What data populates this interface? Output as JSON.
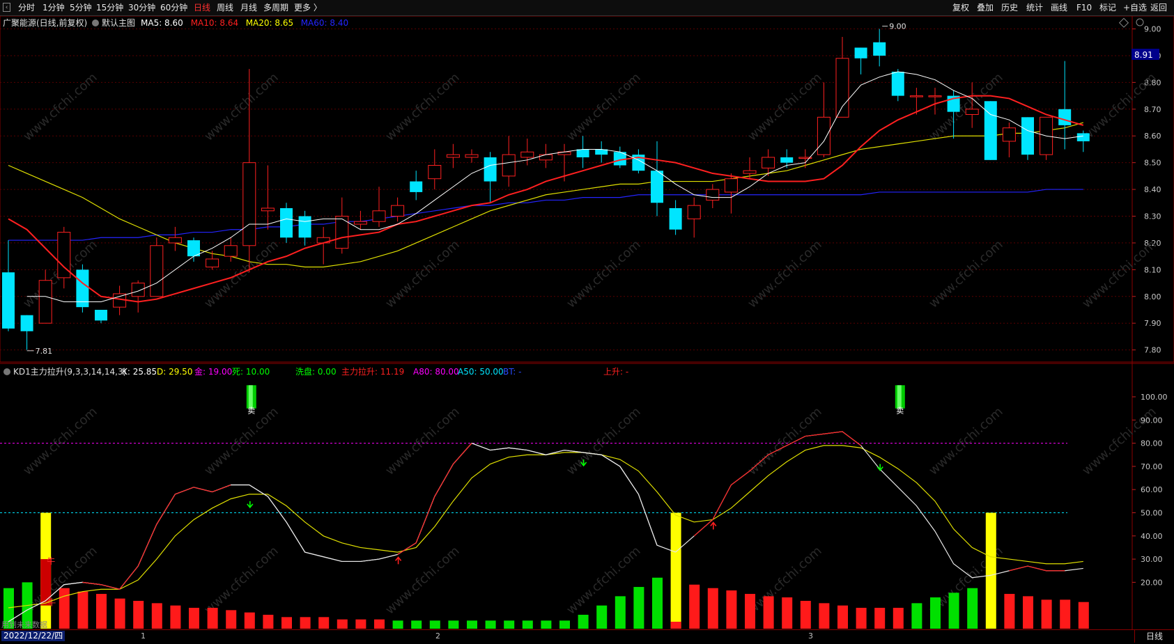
{
  "toolbar": {
    "left": [
      "分时",
      "1分钟",
      "5分钟",
      "15分钟",
      "30分钟",
      "60分钟",
      "日线",
      "周线",
      "月线",
      "多周期",
      "更多 〉"
    ],
    "active": "日线",
    "right": [
      "复权",
      "叠加",
      "历史",
      "统计",
      "画线",
      "F10",
      "标记",
      "+自选",
      "返回"
    ]
  },
  "main_header": {
    "stock": "广聚能源(日线,前复权)",
    "chart_name": "默认主图",
    "ma": [
      {
        "label": "MA5: 8.60",
        "color": "#ffffff"
      },
      {
        "label": "MA10: 8.64",
        "color": "#ff2020"
      },
      {
        "label": "MA20: 8.65",
        "color": "#ffff00"
      },
      {
        "label": "MA60: 8.40",
        "color": "#2424ff"
      }
    ]
  },
  "price_axis": [
    "9.00",
    "8.90",
    "8.80",
    "8.70",
    "8.60",
    "8.50",
    "8.40",
    "8.30",
    "8.20",
    "8.10",
    "8.00",
    "7.90",
    "7.80"
  ],
  "current_price": "8.91",
  "high_label": "9.00",
  "low_label": "7.81",
  "indicator_header": {
    "name": "KD1主力拉升(9,3,3,14,14,3)",
    "items": [
      {
        "label": "K: 25.85",
        "color": "#ffffff"
      },
      {
        "label": "D: 29.50",
        "color": "#ffff00"
      },
      {
        "label": "金: 19.00",
        "color": "#ff00ff"
      },
      {
        "label": "死: 10.00",
        "color": "#00ff00"
      },
      {
        "label": "洗盘: 0.00",
        "color": "#00ff00"
      },
      {
        "label": "主力拉升: 11.19",
        "color": "#ff2020"
      },
      {
        "label": "A80: 80.00",
        "color": "#ff00ff"
      },
      {
        "label": "A50: 50.00",
        "color": "#00e5ff"
      },
      {
        "label": "BT: -",
        "color": "#2a4bff"
      },
      {
        "label": "上升: -",
        "color": "#ff2020"
      }
    ]
  },
  "ind_axis": [
    "100.00",
    "90.00",
    "80.00",
    "70.00",
    "60.00",
    "50.00",
    "40.00",
    "30.00",
    "20.00"
  ],
  "signals": {
    "sell": "卖",
    "cow": "牛"
  },
  "bottom": {
    "date": "2022/12/22/四",
    "months": [
      "1",
      "2",
      "3"
    ],
    "future_note": "用到未来数据",
    "period_button": "日线"
  },
  "watermark": "www.cfchi.com",
  "colors": {
    "up": "#ff2020",
    "down": "#00e5ff",
    "ma5": "#ffffff",
    "ma10": "#ff2020",
    "ma20": "#e0e000",
    "ma60": "#2424ff",
    "k": "#e8e8e8",
    "d": "#e0e000"
  },
  "chart_data": {
    "type": "candlestick",
    "ylim": [
      7.76,
      9.03
    ],
    "candles": [
      [
        8.09,
        7.88,
        8.21,
        7.87
      ],
      [
        7.93,
        7.87,
        7.93,
        7.8
      ],
      [
        7.9,
        8.06,
        8.1,
        7.9
      ],
      [
        8.07,
        8.24,
        8.26,
        8.03
      ],
      [
        8.1,
        7.96,
        8.12,
        7.94
      ],
      [
        7.95,
        7.91,
        7.95,
        7.9
      ],
      [
        7.96,
        8.01,
        8.04,
        7.93
      ],
      [
        8.0,
        8.05,
        8.06,
        7.94
      ],
      [
        8.0,
        8.19,
        8.22,
        8.0
      ],
      [
        8.2,
        8.22,
        8.26,
        8.17
      ],
      [
        8.21,
        8.15,
        8.22,
        8.13
      ],
      [
        8.11,
        8.14,
        8.17,
        8.1
      ],
      [
        8.15,
        8.19,
        8.22,
        8.13
      ],
      [
        8.19,
        8.5,
        8.85,
        8.09
      ],
      [
        8.32,
        8.33,
        8.49,
        8.25
      ],
      [
        8.33,
        8.22,
        8.35,
        8.2
      ],
      [
        8.3,
        8.22,
        8.32,
        8.19
      ],
      [
        8.2,
        8.22,
        8.26,
        8.12
      ],
      [
        8.18,
        8.3,
        8.37,
        8.16
      ],
      [
        8.27,
        8.28,
        8.32,
        8.25
      ],
      [
        8.28,
        8.32,
        8.41,
        8.26
      ],
      [
        8.3,
        8.34,
        8.37,
        8.28
      ],
      [
        8.43,
        8.39,
        8.47,
        8.36
      ],
      [
        8.44,
        8.49,
        8.55,
        8.4
      ],
      [
        8.52,
        8.53,
        8.57,
        8.48
      ],
      [
        8.52,
        8.53,
        8.55,
        8.5
      ],
      [
        8.52,
        8.43,
        8.54,
        8.35
      ],
      [
        8.45,
        8.53,
        8.6,
        8.41
      ],
      [
        8.52,
        8.54,
        8.59,
        8.49
      ],
      [
        8.51,
        8.53,
        8.57,
        8.48
      ],
      [
        8.53,
        8.54,
        8.57,
        8.43
      ],
      [
        8.55,
        8.52,
        8.6,
        8.48
      ],
      [
        8.55,
        8.53,
        8.58,
        8.5
      ],
      [
        8.54,
        8.49,
        8.56,
        8.48
      ],
      [
        8.53,
        8.47,
        8.55,
        8.46
      ],
      [
        8.47,
        8.35,
        8.58,
        8.3
      ],
      [
        8.33,
        8.25,
        8.36,
        8.23
      ],
      [
        8.29,
        8.34,
        8.37,
        8.22
      ],
      [
        8.36,
        8.4,
        8.42,
        8.33
      ],
      [
        8.39,
        8.44,
        8.46,
        8.31
      ],
      [
        8.46,
        8.47,
        8.52,
        8.44
      ],
      [
        8.48,
        8.52,
        8.55,
        8.45
      ],
      [
        8.52,
        8.5,
        8.55,
        8.48
      ],
      [
        8.52,
        8.52,
        8.55,
        8.48
      ],
      [
        8.53,
        8.67,
        8.8,
        8.52
      ],
      [
        8.67,
        8.89,
        8.97,
        8.67
      ],
      [
        8.93,
        8.89,
        8.93,
        8.83
      ],
      [
        8.95,
        8.9,
        9.0,
        8.86
      ],
      [
        8.84,
        8.75,
        8.85,
        8.73
      ],
      [
        8.75,
        8.75,
        8.78,
        8.68
      ],
      [
        8.75,
        8.75,
        8.78,
        8.68
      ],
      [
        8.75,
        8.69,
        8.77,
        8.59
      ],
      [
        8.68,
        8.7,
        8.8,
        8.63
      ],
      [
        8.73,
        8.51,
        8.73,
        8.51
      ],
      [
        8.58,
        8.63,
        8.65,
        8.52
      ],
      [
        8.67,
        8.53,
        8.67,
        8.51
      ],
      [
        8.53,
        8.67,
        8.67,
        8.51
      ],
      [
        8.7,
        8.64,
        8.88,
        8.55
      ],
      [
        8.61,
        8.58,
        8.62,
        8.54
      ]
    ],
    "ma5": [
      null,
      8.0,
      8.0,
      7.98,
      7.98,
      7.98,
      8.0,
      8.02,
      8.05,
      8.1,
      8.15,
      8.18,
      8.22,
      8.27,
      8.27,
      8.29,
      8.28,
      8.29,
      8.29,
      8.25,
      8.25,
      8.27,
      8.31,
      8.36,
      8.41,
      8.46,
      8.49,
      8.5,
      8.51,
      8.53,
      8.54,
      8.55,
      8.55,
      8.54,
      8.51,
      8.47,
      8.42,
      8.38,
      8.37,
      8.37,
      8.41,
      8.46,
      8.49,
      8.5,
      8.58,
      8.71,
      8.79,
      8.82,
      8.84,
      8.83,
      8.81,
      8.77,
      8.74,
      8.68,
      8.66,
      8.62,
      8.6,
      8.59,
      8.6
    ],
    "ma10": [
      8.29,
      8.25,
      8.18,
      8.11,
      8.05,
      8.0,
      7.99,
      7.98,
      7.99,
      8.01,
      8.03,
      8.05,
      8.07,
      8.1,
      8.13,
      8.15,
      8.18,
      8.2,
      8.22,
      8.23,
      8.24,
      8.27,
      8.28,
      8.3,
      8.32,
      8.34,
      8.35,
      8.38,
      8.4,
      8.43,
      8.45,
      8.47,
      8.49,
      8.51,
      8.52,
      8.51,
      8.5,
      8.48,
      8.46,
      8.45,
      8.44,
      8.43,
      8.43,
      8.43,
      8.44,
      8.49,
      8.56,
      8.62,
      8.66,
      8.69,
      8.72,
      8.74,
      8.75,
      8.75,
      8.74,
      8.71,
      8.68,
      8.66,
      8.64
    ],
    "ma20": [
      8.49,
      8.46,
      8.43,
      8.4,
      8.37,
      8.33,
      8.29,
      8.26,
      8.23,
      8.2,
      8.18,
      8.16,
      8.15,
      8.13,
      8.12,
      8.12,
      8.11,
      8.11,
      8.12,
      8.13,
      8.15,
      8.17,
      8.2,
      8.23,
      8.26,
      8.29,
      8.32,
      8.34,
      8.36,
      8.38,
      8.39,
      8.4,
      8.41,
      8.42,
      8.42,
      8.43,
      8.43,
      8.43,
      8.43,
      8.44,
      8.45,
      8.46,
      8.47,
      8.49,
      8.51,
      8.53,
      8.55,
      8.56,
      8.57,
      8.58,
      8.59,
      8.6,
      8.6,
      8.6,
      8.61,
      8.61,
      8.62,
      8.63,
      8.65
    ],
    "ma60": [
      8.21,
      8.21,
      8.21,
      8.21,
      8.21,
      8.22,
      8.22,
      8.22,
      8.23,
      8.23,
      8.24,
      8.24,
      8.25,
      8.25,
      8.26,
      8.26,
      8.27,
      8.27,
      8.28,
      8.28,
      8.29,
      8.3,
      8.31,
      8.32,
      8.33,
      8.34,
      8.34,
      8.35,
      8.35,
      8.36,
      8.36,
      8.37,
      8.37,
      8.37,
      8.38,
      8.38,
      8.38,
      8.38,
      8.38,
      8.38,
      8.38,
      8.38,
      8.38,
      8.38,
      8.38,
      8.38,
      8.38,
      8.39,
      8.39,
      8.39,
      8.39,
      8.39,
      8.39,
      8.39,
      8.39,
      8.39,
      8.4,
      8.4,
      8.4
    ],
    "ind_ylim": [
      0,
      112
    ],
    "K": [
      3,
      8,
      12,
      19,
      20,
      19,
      17,
      27,
      45,
      58,
      61,
      59,
      62,
      62,
      57,
      46,
      33,
      31,
      29,
      29,
      30,
      32,
      37,
      57,
      71,
      80,
      77,
      78,
      77,
      75,
      77,
      76,
      75,
      70,
      58,
      36,
      33,
      40,
      47,
      62,
      68,
      75,
      79,
      83,
      84,
      85,
      79,
      69,
      61,
      53,
      42,
      28,
      22,
      23,
      25,
      27,
      25,
      25,
      26
    ],
    "D": [
      9,
      10,
      11,
      14,
      16,
      17,
      17,
      21,
      30,
      40,
      47,
      52,
      56,
      58,
      58,
      53,
      46,
      40,
      37,
      35,
      34,
      33,
      35,
      44,
      55,
      65,
      71,
      74,
      75,
      75,
      76,
      76,
      75,
      73,
      68,
      59,
      49,
      46,
      47,
      52,
      59,
      66,
      72,
      77,
      79,
      79,
      78,
      74,
      69,
      63,
      55,
      43,
      35,
      31,
      30,
      29,
      28,
      28,
      29
    ],
    "bars": [
      {
        "c": "green",
        "v": 17.5
      },
      {
        "c": "green",
        "v": 20
      },
      {
        "c": "yellow",
        "v": 50
      },
      {
        "c": "red",
        "v": 17.5
      },
      {
        "c": "red",
        "v": 16
      },
      {
        "c": "red",
        "v": 15
      },
      {
        "c": "red",
        "v": 13
      },
      {
        "c": "red",
        "v": 12
      },
      {
        "c": "red",
        "v": 11
      },
      {
        "c": "red",
        "v": 10
      },
      {
        "c": "red",
        "v": 9
      },
      {
        "c": "red",
        "v": 9
      },
      {
        "c": "red",
        "v": 8
      },
      {
        "c": "red",
        "v": 7
      },
      {
        "c": "red",
        "v": 6
      },
      {
        "c": "red",
        "v": 5
      },
      {
        "c": "red",
        "v": 5
      },
      {
        "c": "red",
        "v": 5
      },
      {
        "c": "red",
        "v": 4
      },
      {
        "c": "red",
        "v": 4
      },
      {
        "c": "red",
        "v": 4
      },
      {
        "c": "green",
        "v": 3.5
      },
      {
        "c": "green",
        "v": 3.5
      },
      {
        "c": "green",
        "v": 3.5
      },
      {
        "c": "green",
        "v": 3.5
      },
      {
        "c": "green",
        "v": 3.5
      },
      {
        "c": "green",
        "v": 3.5
      },
      {
        "c": "green",
        "v": 3.5
      },
      {
        "c": "green",
        "v": 3.5
      },
      {
        "c": "green",
        "v": 3.5
      },
      {
        "c": "green",
        "v": 3.5
      },
      {
        "c": "green",
        "v": 6
      },
      {
        "c": "green",
        "v": 10
      },
      {
        "c": "green",
        "v": 14
      },
      {
        "c": "green",
        "v": 18
      },
      {
        "c": "green",
        "v": 22
      },
      {
        "c": "yellow",
        "v": 50
      },
      {
        "c": "red",
        "v": 19
      },
      {
        "c": "red",
        "v": 17.5
      },
      {
        "c": "red",
        "v": 16.5
      },
      {
        "c": "red",
        "v": 15
      },
      {
        "c": "red",
        "v": 14
      },
      {
        "c": "red",
        "v": 13.5
      },
      {
        "c": "red",
        "v": 12
      },
      {
        "c": "red",
        "v": 11
      },
      {
        "c": "red",
        "v": 10
      },
      {
        "c": "red",
        "v": 9
      },
      {
        "c": "red",
        "v": 9
      },
      {
        "c": "red",
        "v": 9
      },
      {
        "c": "green",
        "v": 11
      },
      {
        "c": "green",
        "v": 13.5
      },
      {
        "c": "green",
        "v": 15.5
      },
      {
        "c": "green",
        "v": 17.5
      },
      {
        "c": "yellow",
        "v": 50
      },
      {
        "c": "red",
        "v": 15
      },
      {
        "c": "red",
        "v": 14
      },
      {
        "c": "red",
        "v": 12.5
      },
      {
        "c": "red",
        "v": 12.5
      },
      {
        "c": "red",
        "v": 11.5
      }
    ],
    "arrows_down": [
      13,
      31,
      47
    ],
    "arrows_up": [
      21,
      38
    ],
    "sell_signals": [
      13,
      48
    ]
  }
}
